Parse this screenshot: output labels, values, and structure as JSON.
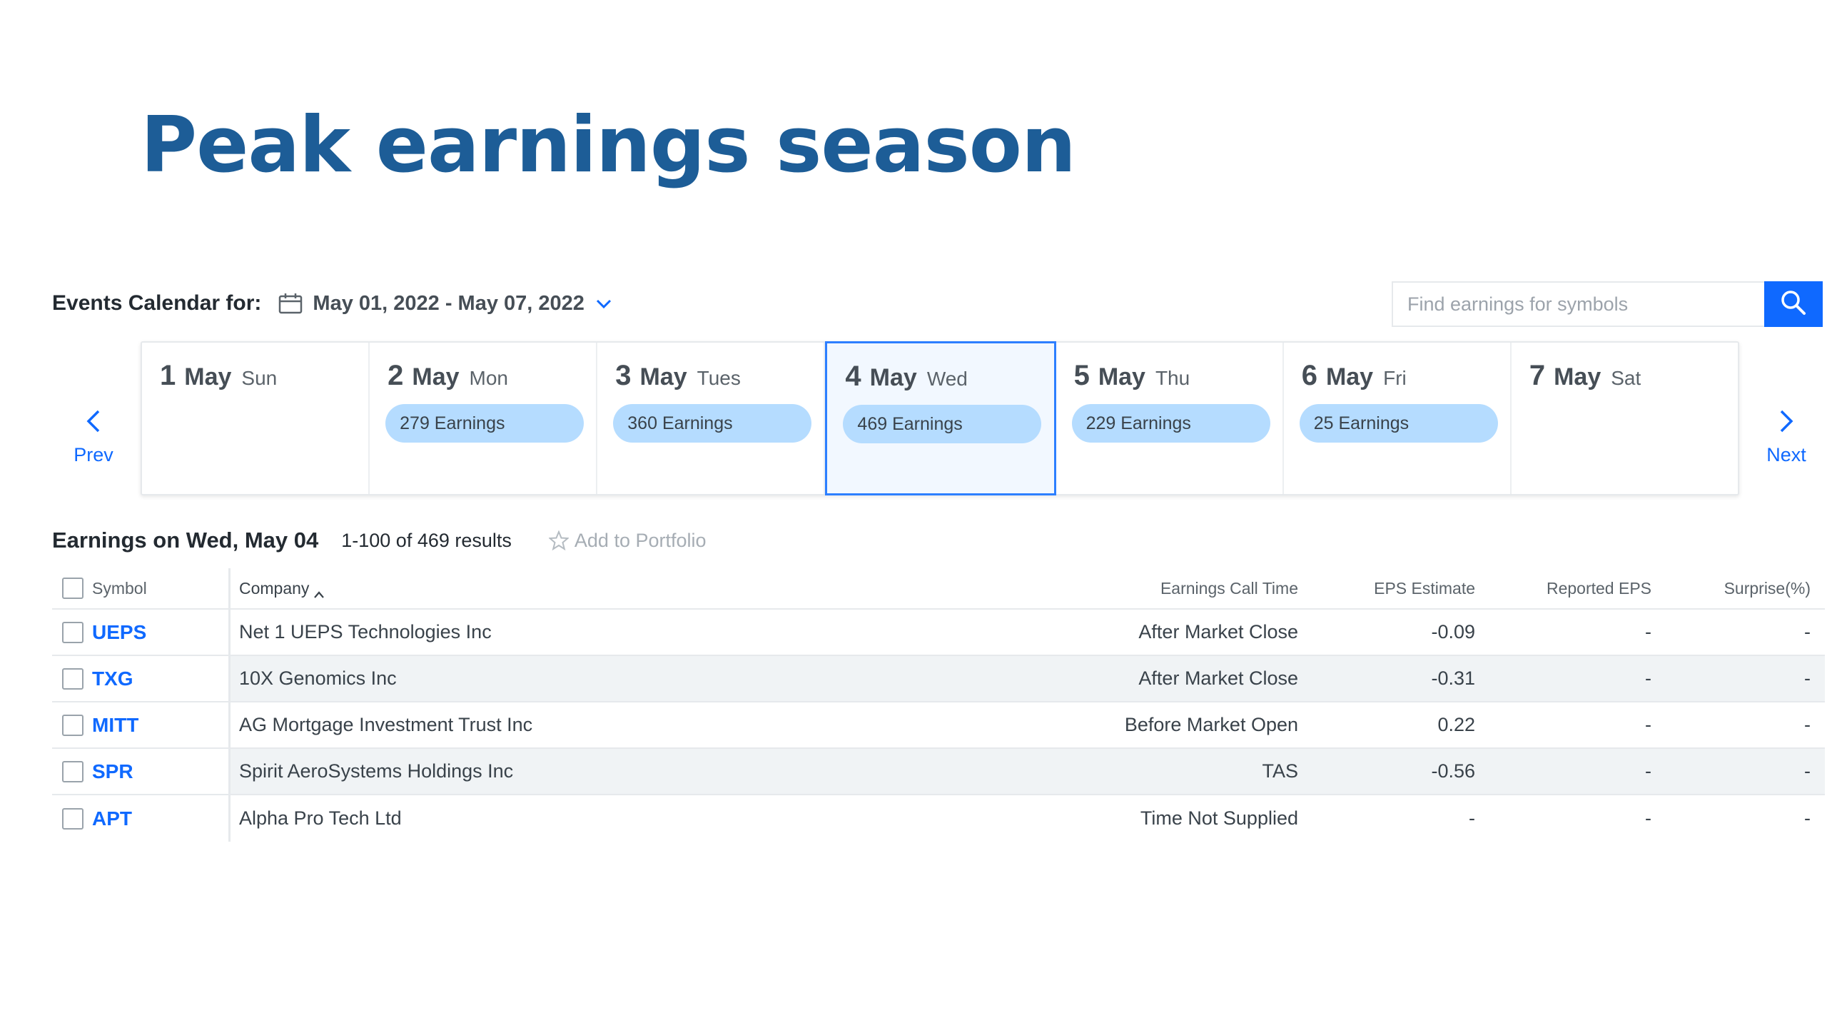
{
  "slide": {
    "title": "Peak earnings season"
  },
  "calendar": {
    "label": "Events Calendar for:",
    "range": "May 01, 2022 - May 07, 2022",
    "search_placeholder": "Find earnings for symbols",
    "prev_label": "Prev",
    "next_label": "Next",
    "days": [
      {
        "num": "1",
        "month": "May",
        "dow": "Sun",
        "earnings": ""
      },
      {
        "num": "2",
        "month": "May",
        "dow": "Mon",
        "earnings": "279 Earnings"
      },
      {
        "num": "3",
        "month": "May",
        "dow": "Tues",
        "earnings": "360 Earnings"
      },
      {
        "num": "4",
        "month": "May",
        "dow": "Wed",
        "earnings": "469 Earnings"
      },
      {
        "num": "5",
        "month": "May",
        "dow": "Thu",
        "earnings": "229 Earnings"
      },
      {
        "num": "6",
        "month": "May",
        "dow": "Fri",
        "earnings": "25 Earnings"
      },
      {
        "num": "7",
        "month": "May",
        "dow": "Sat",
        "earnings": ""
      }
    ],
    "selected_index": 3
  },
  "results": {
    "title": "Earnings on Wed, May 04",
    "count": "1-100 of 469 results",
    "add_portfolio": "Add to Portfolio"
  },
  "table": {
    "headers": {
      "symbol": "Symbol",
      "company": "Company",
      "call_time": "Earnings Call Time",
      "eps_estimate": "EPS Estimate",
      "reported_eps": "Reported EPS",
      "surprise": "Surprise(%)"
    },
    "rows": [
      {
        "symbol": "UEPS",
        "company": "Net 1 UEPS Technologies Inc",
        "call_time": "After Market Close",
        "eps_estimate": "-0.09",
        "reported_eps": "-",
        "surprise": "-"
      },
      {
        "symbol": "TXG",
        "company": "10X Genomics Inc",
        "call_time": "After Market Close",
        "eps_estimate": "-0.31",
        "reported_eps": "-",
        "surprise": "-"
      },
      {
        "symbol": "MITT",
        "company": "AG Mortgage Investment Trust Inc",
        "call_time": "Before Market Open",
        "eps_estimate": "0.22",
        "reported_eps": "-",
        "surprise": "-"
      },
      {
        "symbol": "SPR",
        "company": "Spirit AeroSystems Holdings Inc",
        "call_time": "TAS",
        "eps_estimate": "-0.56",
        "reported_eps": "-",
        "surprise": "-"
      },
      {
        "symbol": "APT",
        "company": "Alpha Pro Tech Ltd",
        "call_time": "Time Not Supplied",
        "eps_estimate": "-",
        "reported_eps": "-",
        "surprise": "-"
      }
    ]
  },
  "colors": {
    "title_blue": "#1d5d97",
    "link_blue": "#0f69ff",
    "pill_blue": "#b5dcff",
    "selected_border": "#2d7fff"
  }
}
